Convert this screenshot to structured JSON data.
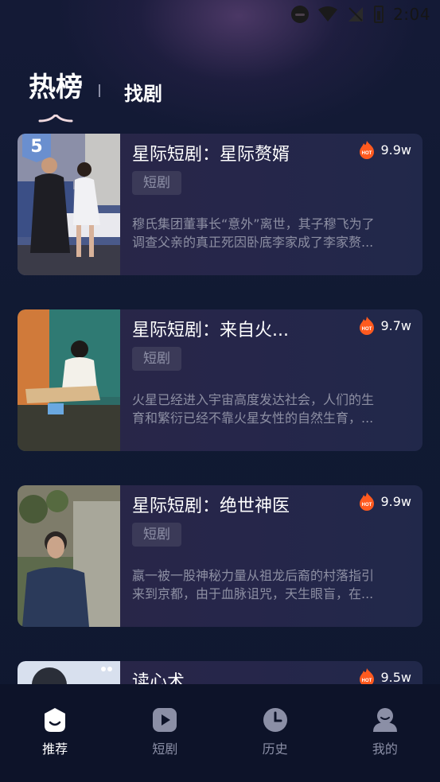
{
  "status_bar": {
    "time": "2:04"
  },
  "tabs": {
    "hot": "热榜",
    "find": "找剧"
  },
  "dramas": [
    {
      "rank": "5",
      "title": "星际短剧：星际赘婿",
      "heat": "9.9w",
      "tag": "短剧",
      "desc_line1": "穆氏集团董事长“意外”离世，其子穆飞为了",
      "desc_line2": "调查父亲的真正死因卧底李家成了李家赘..."
    },
    {
      "rank": "",
      "title": "星际短剧：来自火...",
      "heat": "9.7w",
      "tag": "短剧",
      "desc_line1": "火星已经进入宇宙高度发达社会，人们的生",
      "desc_line2": "育和繁衍已经不靠火星女性的自然生育，..."
    },
    {
      "rank": "",
      "title": "星际短剧：绝世神医",
      "heat": "9.9w",
      "tag": "短剧",
      "desc_line1": "嬴一被一股神秘力量从祖龙后裔的村落指引",
      "desc_line2": "来到京都，由于血脉诅咒，天生眼盲，在..."
    },
    {
      "rank": "",
      "title": "读心术",
      "heat": "9.5w",
      "tag": "",
      "desc_line1": "",
      "desc_line2": ""
    }
  ],
  "bottom_nav": [
    {
      "label": "推荐",
      "icon": "recommend-icon",
      "active": true
    },
    {
      "label": "短剧",
      "icon": "play-icon",
      "active": false
    },
    {
      "label": "历史",
      "icon": "clock-icon",
      "active": false
    },
    {
      "label": "我的",
      "icon": "profile-icon",
      "active": false
    }
  ],
  "colors": {
    "background": "#111a33",
    "card": "#27274a",
    "hot_icon": "#ff5a1f",
    "rank_badge": "#6a8fcf"
  }
}
